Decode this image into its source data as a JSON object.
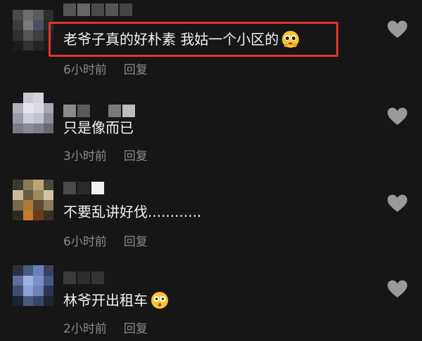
{
  "comments": [
    {
      "text": "老爷子真的好朴素 我姑一个小区的",
      "time": "6小时前",
      "reply": "回复",
      "emoji": "pleading-face-emoji"
    },
    {
      "text": "只是像而已",
      "time": "3小时前",
      "reply": "回复"
    },
    {
      "text": "不要乱讲好伐............",
      "time": "6小时前",
      "reply": "回复"
    },
    {
      "text": "林爷开出租车",
      "time": "2小时前",
      "reply": "回复",
      "emoji": "flushed-face-emoji"
    }
  ],
  "colors": {
    "highlight": "#e0352b",
    "background": "#161616",
    "meta": "#8a8a8a"
  }
}
